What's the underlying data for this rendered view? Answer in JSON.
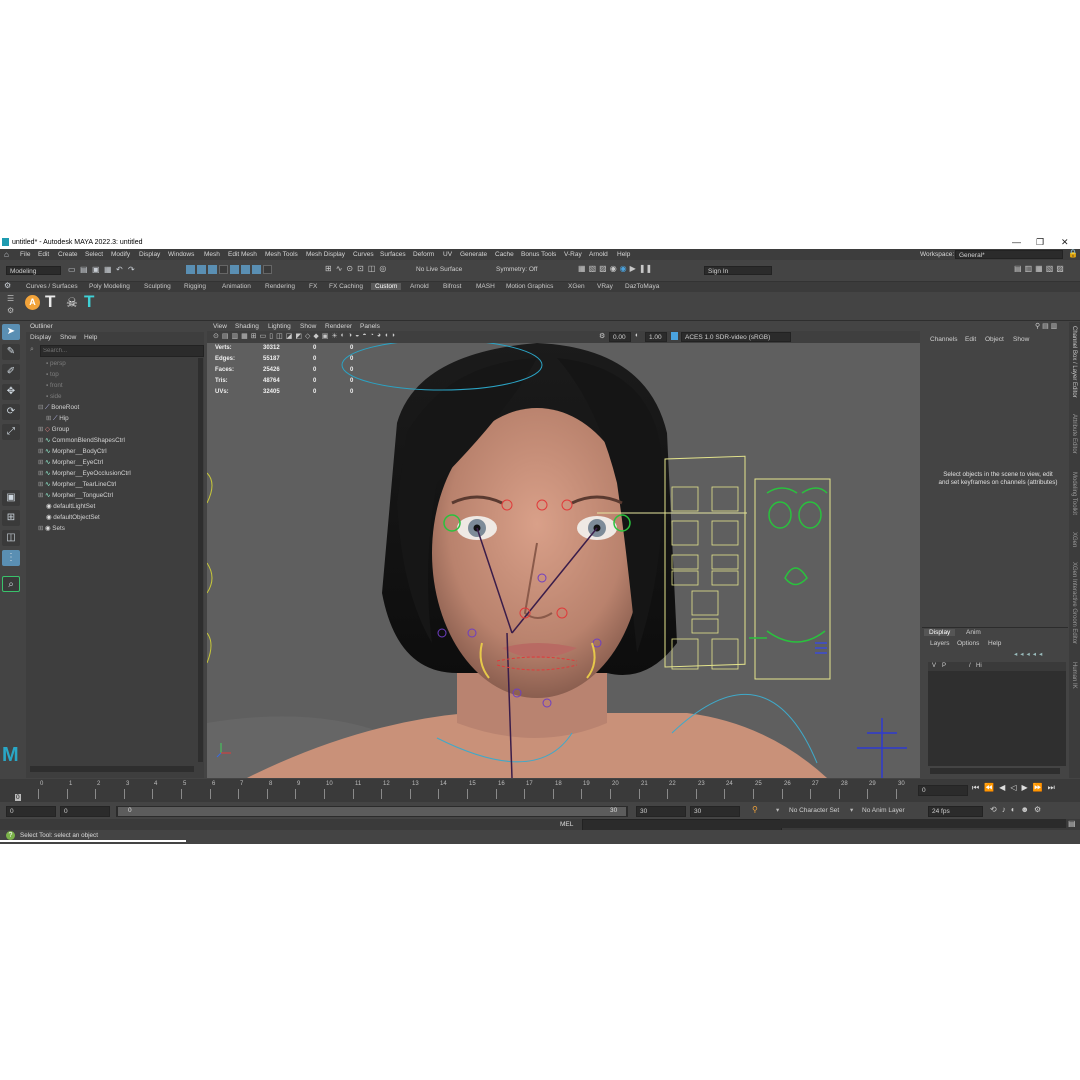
{
  "window": {
    "title": "untitled* - Autodesk MAYA 2022.3: untitled",
    "minimize": "—",
    "maximize": "❐",
    "close": "✕"
  },
  "menu": [
    "File",
    "Edit",
    "Create",
    "Select",
    "Modify",
    "Display",
    "Windows",
    "Mesh",
    "Edit Mesh",
    "Mesh Tools",
    "Mesh Display",
    "Curves",
    "Surfaces",
    "Deform",
    "UV",
    "Generate",
    "Cache",
    "Bonus Tools",
    "V-Ray",
    "Arnold",
    "Help"
  ],
  "workspace": {
    "label": "Workspace:",
    "value": "General*"
  },
  "status": {
    "mode": "Modeling",
    "live_surface": "No Live Surface",
    "symmetry": "Symmetry: Off",
    "sign_in": "Sign In"
  },
  "shelf_tabs": [
    "Curves / Surfaces",
    "Poly Modeling",
    "Sculpting",
    "Rigging",
    "Animation",
    "Rendering",
    "FX",
    "FX Caching",
    "Custom",
    "Arnold",
    "Bifrost",
    "MASH",
    "Motion Graphics",
    "XGen",
    "VRay",
    "DazToMaya"
  ],
  "shelf_active": "Custom",
  "outliner": {
    "title": "Outliner",
    "menus": [
      "Display",
      "Show",
      "Help"
    ],
    "search_placeholder": "Search...",
    "items": [
      "persp",
      "top",
      "front",
      "side",
      "BoneRoot",
      "Hip",
      "Group",
      "CommonBlendShapesCtrl",
      "Morpher__BodyCtrl",
      "Morpher__EyeCtrl",
      "Morpher__EyeOcclusionCtrl",
      "Morpher__TearLineCtrl",
      "Morpher__TongueCtrl",
      "defaultLightSet",
      "defaultObjectSet",
      "Sets"
    ]
  },
  "viewport": {
    "menus": [
      "View",
      "Shading",
      "Lighting",
      "Show",
      "Renderer",
      "Panels"
    ],
    "exposure": "0.00",
    "gamma": "1.00",
    "color_space": "ACES 1.0 SDR-video (sRGB)",
    "hud": [
      {
        "label": "Verts:",
        "a": "30312",
        "b": "0",
        "c": "0"
      },
      {
        "label": "Edges:",
        "a": "55187",
        "b": "0",
        "c": "0"
      },
      {
        "label": "Faces:",
        "a": "25426",
        "b": "0",
        "c": "0"
      },
      {
        "label": "Tris:",
        "a": "48764",
        "b": "0",
        "c": "0"
      },
      {
        "label": "UVs:",
        "a": "32405",
        "b": "0",
        "c": "0"
      }
    ]
  },
  "channel_box": {
    "menus": [
      "Channels",
      "Edit",
      "Object",
      "Show"
    ],
    "message": "Select objects in the scene to view, edit and set keyframes on channels (attributes)"
  },
  "layer_editor": {
    "tabs": [
      "Display",
      "Anim"
    ],
    "menus": [
      "Layers",
      "Options",
      "Help"
    ],
    "layer": {
      "v": "V",
      "p": "P",
      "slash": "/",
      "name": "Hi"
    }
  },
  "side_tabs": [
    "Channel Box / Layer Editor",
    "Attribute Editor",
    "Modeling Toolkit",
    "XGen",
    "XGen Interactive Groom Editor",
    "Human IK"
  ],
  "timeline": {
    "ticks": [
      "0",
      "1",
      "2",
      "3",
      "4",
      "5",
      "6",
      "7",
      "8",
      "9",
      "10",
      "11",
      "12",
      "13",
      "14",
      "15",
      "16",
      "17",
      "18",
      "19",
      "20",
      "21",
      "22",
      "23",
      "24",
      "25",
      "26",
      "27",
      "28",
      "29",
      "30"
    ],
    "current_frame": "0",
    "current_field": "0"
  },
  "range": {
    "start": "0",
    "start_inner": "0",
    "slider_start": "0",
    "slider_end": "30",
    "end_inner": "30",
    "end": "30",
    "character_set": "No Character Set",
    "anim_layer": "No Anim Layer",
    "fps": "24 fps"
  },
  "command": {
    "lang": "MEL"
  },
  "help": {
    "text": "Select Tool: select an object"
  }
}
